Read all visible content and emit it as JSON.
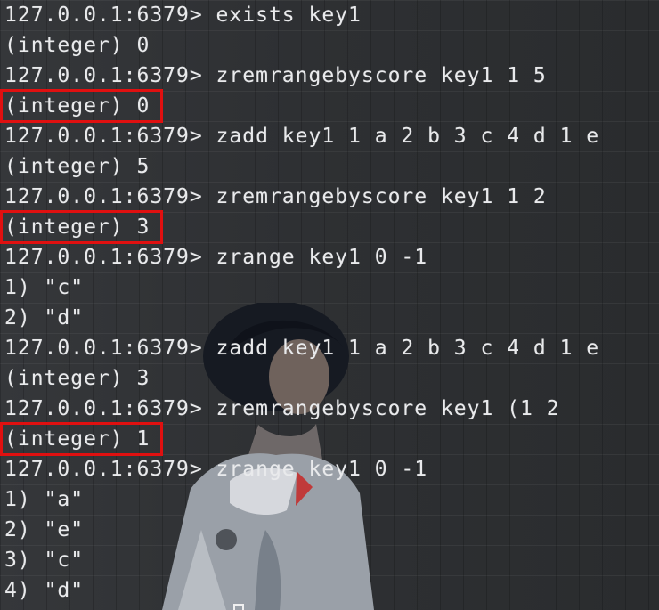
{
  "lines": [
    {
      "text": "127.0.0.1:6379> exists key1",
      "highlight": false
    },
    {
      "text": "(integer) 0",
      "highlight": false
    },
    {
      "text": "127.0.0.1:6379> zremrangebyscore key1 1 5",
      "highlight": false
    },
    {
      "text": "(integer) 0",
      "highlight": true
    },
    {
      "text": "127.0.0.1:6379> zadd key1 1 a 2 b 3 c 4 d 1 e",
      "highlight": false
    },
    {
      "text": "(integer) 5",
      "highlight": false
    },
    {
      "text": "127.0.0.1:6379> zremrangebyscore key1 1 2",
      "highlight": false
    },
    {
      "text": "(integer) 3",
      "highlight": true
    },
    {
      "text": "127.0.0.1:6379> zrange key1 0 -1",
      "highlight": false
    },
    {
      "text": "1) \"c\"",
      "highlight": false
    },
    {
      "text": "2) \"d\"",
      "highlight": false
    },
    {
      "text": "127.0.0.1:6379> zadd key1 1 a 2 b 3 c 4 d 1 e",
      "highlight": false
    },
    {
      "text": "(integer) 3",
      "highlight": false
    },
    {
      "text": "127.0.0.1:6379> zremrangebyscore key1 (1 2",
      "highlight": false
    },
    {
      "text": "(integer) 1",
      "highlight": true
    },
    {
      "text": "127.0.0.1:6379> zrange key1 0 -1",
      "highlight": false
    },
    {
      "text": "1) \"a\"",
      "highlight": false
    },
    {
      "text": "2) \"e\"",
      "highlight": false
    },
    {
      "text": "3) \"c\"",
      "highlight": false
    },
    {
      "text": "4) \"d\"",
      "highlight": false
    }
  ],
  "colors": {
    "text": "#e9eaec",
    "highlight_border": "#e01010",
    "background": "#2e3033"
  }
}
